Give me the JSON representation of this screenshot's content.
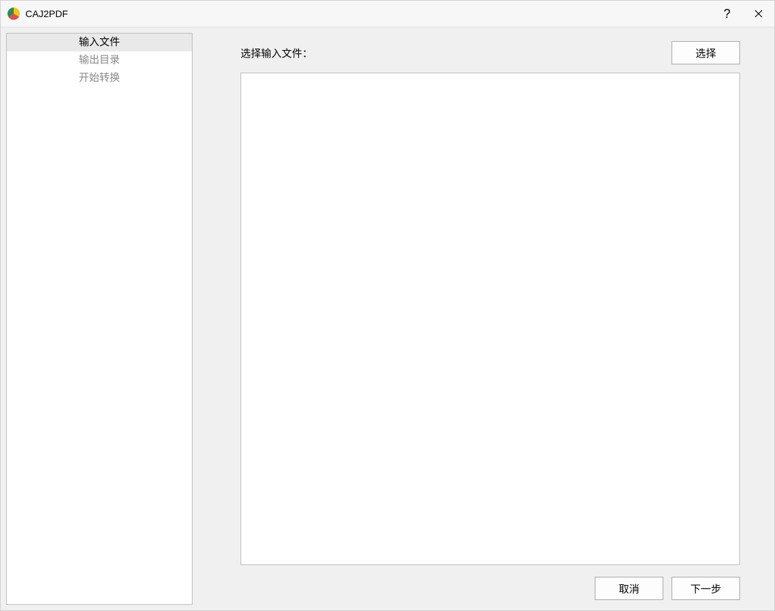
{
  "titlebar": {
    "app_title": "CAJ2PDF"
  },
  "sidebar": {
    "steps": [
      {
        "label": "输入文件",
        "active": true
      },
      {
        "label": "输出目录",
        "active": false
      },
      {
        "label": "开始转换",
        "active": false
      }
    ]
  },
  "main": {
    "select_input_label": "选择输入文件：",
    "select_button": "选择"
  },
  "footer": {
    "cancel": "取消",
    "next": "下一步"
  }
}
